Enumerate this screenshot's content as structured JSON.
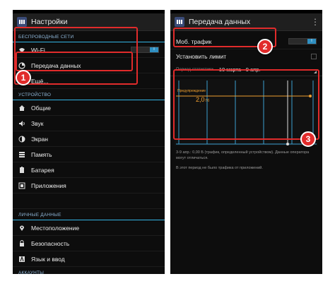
{
  "left": {
    "title": "Настройки",
    "sections": {
      "wireless": "БЕСПРОВОДНЫЕ СЕТИ",
      "device": "УСТРОЙСТВО",
      "personal": "ЛИЧНЫЕ ДАННЫЕ",
      "accounts": "АККАУНТЫ"
    },
    "wifi": {
      "label": "Wi-Fi",
      "toggle": "I"
    },
    "data_usage": "Передача данных",
    "more": "Ещё...",
    "device_items": [
      {
        "label": "Общие",
        "icon": "home-icon"
      },
      {
        "label": "Звук",
        "icon": "speaker-icon"
      },
      {
        "label": "Экран",
        "icon": "brightness-icon"
      },
      {
        "label": "Память",
        "icon": "storage-icon"
      },
      {
        "label": "Батарея",
        "icon": "battery-icon"
      },
      {
        "label": "Приложения",
        "icon": "apps-icon"
      }
    ],
    "personal_items": [
      {
        "label": "Местоположение",
        "icon": "location-icon"
      },
      {
        "label": "Безопасность",
        "icon": "lock-icon"
      },
      {
        "label": "Язык и ввод",
        "icon": "language-icon"
      }
    ]
  },
  "right": {
    "title": "Передача данных",
    "mobile_traffic": {
      "label": "Моб. трафик",
      "toggle": "I"
    },
    "set_limit": "Установить лимит",
    "period_label": "Период статистики",
    "period_value": "10 марта - 9 апр.",
    "warning_label": "Предупреждение",
    "warning_value": "2,0",
    "warning_unit": "Гб",
    "note1": "3-9 апр.: 0,00 Б (трафик, определенный устройством). Данные оператора могут отличаться.",
    "note2": "В этот период не было трафика от приложений."
  },
  "badges": {
    "one": "1",
    "two": "2",
    "three": "3"
  },
  "colors": {
    "annotation": "#e12b2b",
    "accent": "#33b5e5",
    "warning": "#f0a030",
    "toggle_on": "#2f8fc1"
  }
}
